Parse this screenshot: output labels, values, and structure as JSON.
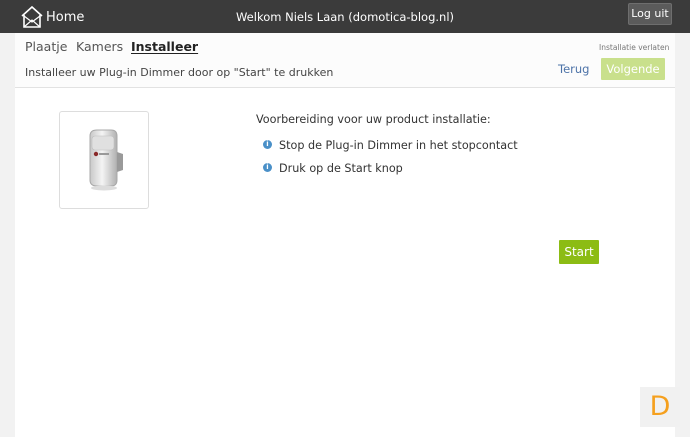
{
  "topbar": {
    "home_label": "Home",
    "home_icon": "house-icon",
    "welcome": "Welkom Niels Laan (domotica-blog.nl)",
    "logout": "Log uit"
  },
  "tabs": [
    {
      "label": "Plaatje",
      "active": false
    },
    {
      "label": "Kamers",
      "active": false
    },
    {
      "label": "Installeer",
      "active": true
    }
  ],
  "subheader": {
    "leave": "Installatie verlaten",
    "instruction": "Installeer uw Plug-in Dimmer door op \"Start\" te drukken",
    "back": "Terug",
    "next": "Volgende"
  },
  "content": {
    "product_image": "plug-in-dimmer-device",
    "prep_title": "Voorbereiding voor uw product installatie:",
    "steps": [
      "Stop de Plug-in Dimmer in het stopcontact",
      "Druk op de Start knop"
    ],
    "start": "Start"
  },
  "watermark": "D",
  "colors": {
    "topbar": "#3b3b3b",
    "accent_green": "#8cbc14",
    "disabled_green": "#c9e08c",
    "link_blue": "#4d73a8",
    "info_blue": "#4a90c8",
    "watermark_orange": "#f5a01e"
  }
}
